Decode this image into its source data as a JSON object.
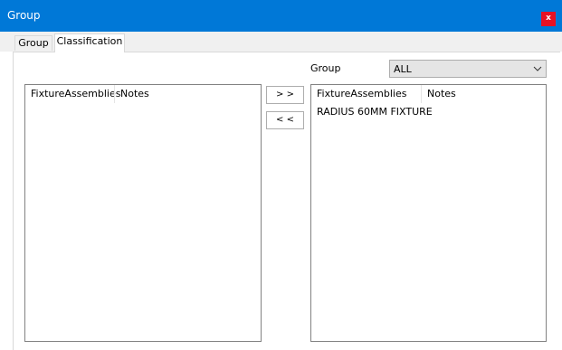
{
  "window": {
    "title": "Group",
    "close_label": "x"
  },
  "tabs": [
    {
      "label": "Group",
      "active": false
    },
    {
      "label": "Classification",
      "active": true
    }
  ],
  "group_filter": {
    "label": "Group",
    "value": "ALL"
  },
  "left_list": {
    "columns": [
      "FixtureAssemblies",
      "Notes"
    ],
    "rows": []
  },
  "right_list": {
    "columns": [
      "FixtureAssemblies",
      "Notes"
    ],
    "rows": [
      {
        "name": "RADIUS 60MM FIXTURE",
        "notes": ""
      }
    ]
  },
  "buttons": {
    "move_right": "> >",
    "move_left": "< <"
  },
  "colors": {
    "title_bar": "#0078d7",
    "close_button": "#e81123"
  }
}
